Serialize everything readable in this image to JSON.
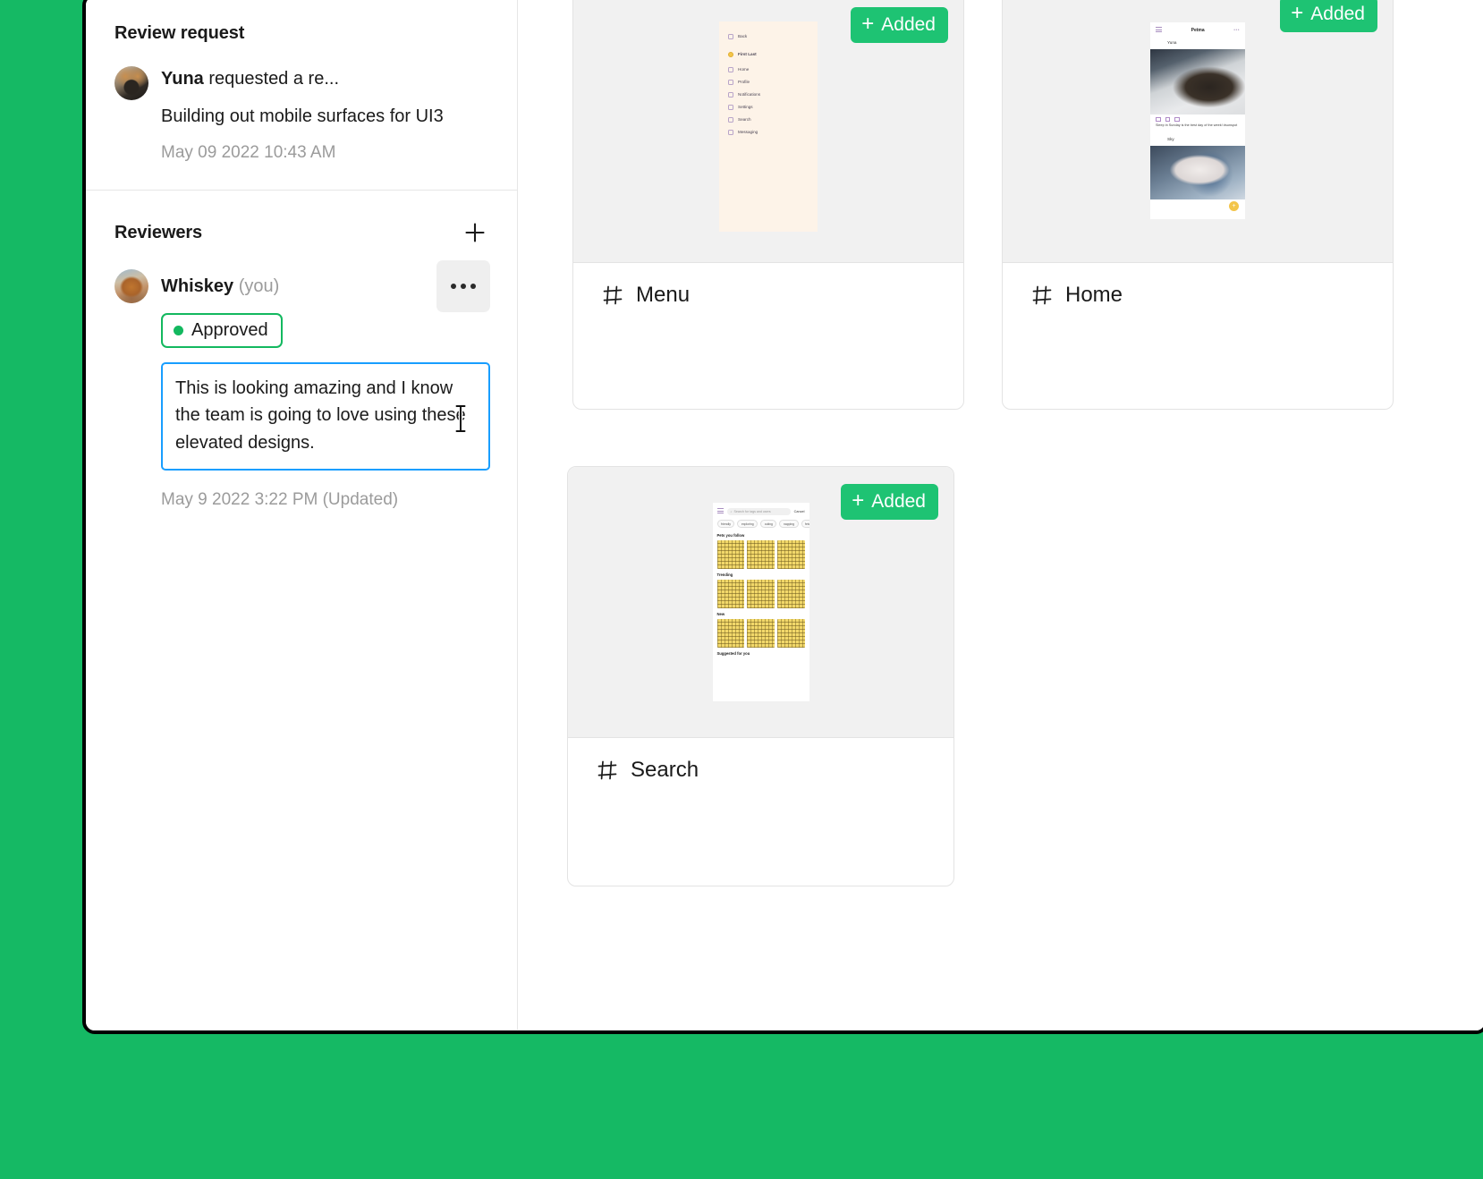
{
  "review_request": {
    "title": "Review request",
    "requester": "Yuna",
    "action_text": " requested a re...",
    "subject": "Building out mobile surfaces for UI3",
    "timestamp": "May 09 2022 10:43 AM",
    "avatar_name": "yuna-avatar"
  },
  "reviewers": {
    "title": "Reviewers",
    "add_icon": "plus-icon",
    "menu_icon": "more-options-icon",
    "list": [
      {
        "name": "Whiskey",
        "you_label": "(you)",
        "status": "Approved",
        "status_color": "#13b85f",
        "comment": "This is looking amazing and I know the team is going to love using these elevated designs.",
        "timestamp": "May 9 2022 3:22 PM (Updated)",
        "avatar_name": "whiskey-avatar"
      }
    ]
  },
  "canvas": {
    "frames": [
      {
        "label": "Menu",
        "icon": "frame-icon",
        "badge": "Added",
        "badge_plus": "+",
        "badge_color": "#1ec373",
        "preview": {
          "kind": "menu-screen",
          "items": [
            {
              "label": "Back",
              "icon": "back-arrow-icon"
            },
            {
              "label": "First Last",
              "icon": "user-avatar-icon"
            },
            {
              "label": "Home",
              "icon": "home-icon"
            },
            {
              "label": "Profile",
              "icon": "profile-icon"
            },
            {
              "label": "Notifications",
              "icon": "bell-icon"
            },
            {
              "label": "Settings",
              "icon": "gear-icon"
            },
            {
              "label": "Search",
              "icon": "search-icon"
            },
            {
              "label": "Messaging",
              "icon": "message-icon"
            }
          ]
        }
      },
      {
        "label": "Home",
        "icon": "frame-icon",
        "badge": "Added",
        "badge_plus": "+",
        "badge_color": "#1ec373",
        "preview": {
          "kind": "home-feed-screen",
          "app_title": "Petma",
          "menu_icon": "hamburger-icon",
          "overflow_icon": "more-icon",
          "posts": [
            {
              "user": "Yuna",
              "caption": "Sleep in Sunday is the best day of the week! #sunspot",
              "actions": [
                "heart-icon",
                "comment-icon",
                "bookmark-icon"
              ]
            },
            {
              "user": "Sky",
              "caption": "",
              "actions": []
            }
          ],
          "fab_icon": "plus-icon"
        }
      },
      {
        "label": "Search",
        "icon": "frame-icon",
        "badge": "Added",
        "badge_plus": "+",
        "badge_color": "#1ec373",
        "preview": {
          "kind": "search-screen",
          "menu_icon": "hamburger-icon",
          "search_placeholder": "Search for tags and users",
          "search_icon": "search-icon",
          "cancel_label": "Cancel",
          "chips": [
            "friendly",
            "exploring",
            "outing",
            "napping",
            "fetch"
          ],
          "sections": [
            "Pets you follow",
            "Trending",
            "New",
            "Suggested for you"
          ]
        }
      }
    ]
  }
}
